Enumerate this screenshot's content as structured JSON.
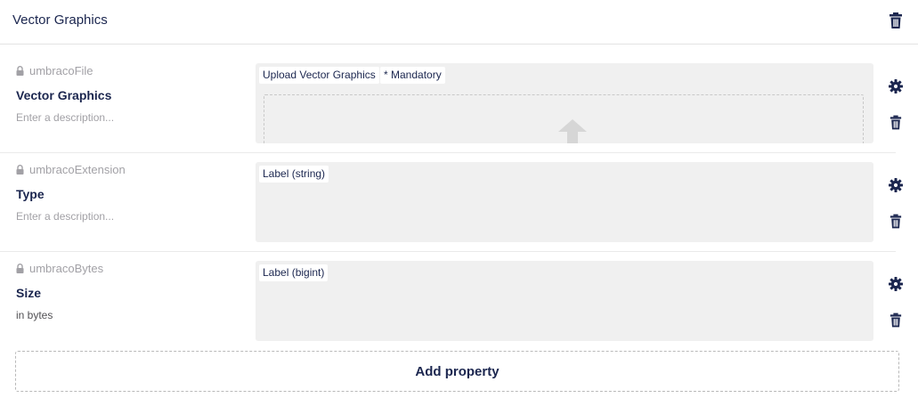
{
  "group": {
    "title": "Vector Graphics"
  },
  "properties": [
    {
      "alias": "umbracoFile",
      "name": "Vector Graphics",
      "description": "Enter a description...",
      "editor_label": "Upload Vector Graphics",
      "mandatory_label": "* Mandatory"
    },
    {
      "alias": "umbracoExtension",
      "name": "Type",
      "description": "Enter a description...",
      "editor_label": "Label (string)"
    },
    {
      "alias": "umbracoBytes",
      "name": "Size",
      "description": "in bytes",
      "editor_label": "Label (bigint)"
    }
  ],
  "add_property_label": "Add property",
  "colors": {
    "primary_text": "#1b264f",
    "muted_text": "#a2a1a6",
    "preview_bg": "#f0f0f0"
  },
  "icons": {
    "lock": "lock-icon",
    "settings": "gear-icon",
    "delete": "trash-icon",
    "upload": "upload-arrow-icon"
  }
}
